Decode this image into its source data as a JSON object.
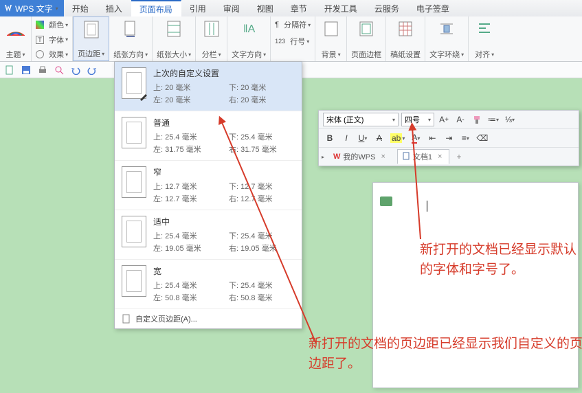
{
  "app": {
    "name": "WPS 文字"
  },
  "tabs": [
    "开始",
    "插入",
    "页面布局",
    "引用",
    "审阅",
    "视图",
    "章节",
    "开发工具",
    "云服务",
    "电子签章"
  ],
  "active_tab_index": 2,
  "ribbon": {
    "theme": "主题",
    "color": "颜色",
    "font": "字体",
    "effect": "效果",
    "margins": "页边距",
    "orientation": "纸张方向",
    "size": "纸张大小",
    "columns": "分栏",
    "textdir": "文字方向",
    "breaks": "分隔符",
    "linenum": "行号",
    "background": "背景",
    "border": "页面边框",
    "manuscript": "稿纸设置",
    "wrap": "文字环绕",
    "align": "对齐"
  },
  "margins_menu": {
    "last": {
      "title": "上次的自定义设置",
      "top": "上: 20 毫米",
      "bottom": "下: 20 毫米",
      "left": "左: 20 毫米",
      "right": "右: 20 毫米"
    },
    "normal": {
      "title": "普通",
      "top": "上: 25.4 毫米",
      "bottom": "下: 25.4 毫米",
      "left": "左: 31.75 毫米",
      "right": "右: 31.75 毫米"
    },
    "narrow": {
      "title": "窄",
      "top": "上: 12.7 毫米",
      "bottom": "下: 12.7 毫米",
      "left": "左: 12.7 毫米",
      "right": "右: 12.7 毫米"
    },
    "moderate": {
      "title": "适中",
      "top": "上: 25.4 毫米",
      "bottom": "下: 25.4 毫米",
      "left": "左: 19.05 毫米",
      "right": "右: 19.05 毫米"
    },
    "wide": {
      "title": "宽",
      "top": "上: 25.4 毫米",
      "bottom": "下: 25.4 毫米",
      "left": "左: 50.8 毫米",
      "right": "右: 50.8 毫米"
    },
    "custom": "自定义页边距(A)..."
  },
  "float_toolbar": {
    "font": "宋体 (正文)",
    "size": "四号",
    "tabs": {
      "wps": "我的WPS",
      "doc": "文档1"
    }
  },
  "annotations": {
    "right": "新打开的文档已经显示默认的字体和字号了。",
    "bottom": "新打开的文档的页边距已经显示我们自定义的页边距了。"
  }
}
